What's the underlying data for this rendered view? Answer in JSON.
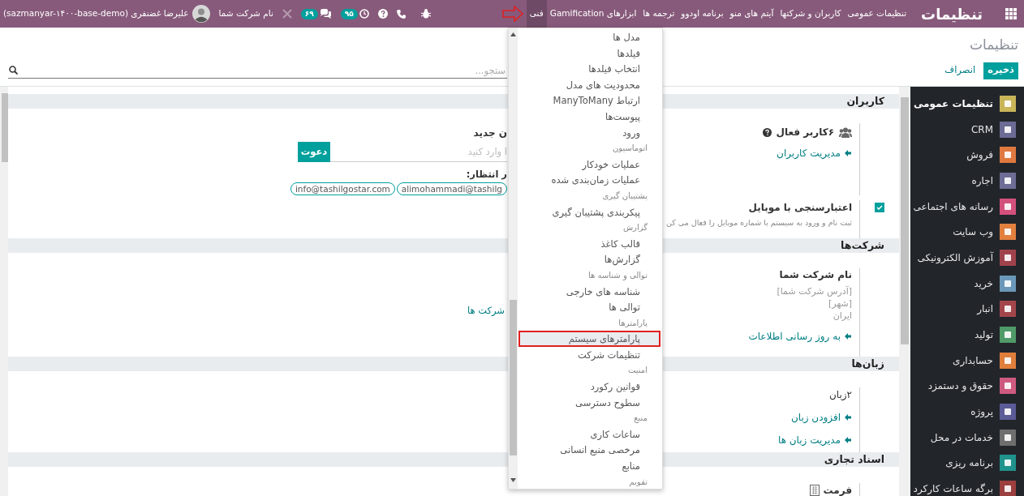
{
  "navbar": {
    "brand": "تنظیمات",
    "menu": [
      {
        "label": "تنظیمات عمومی",
        "selected": false
      },
      {
        "label": "کاربران و شرکتها",
        "selected": false
      },
      {
        "label": "آیتم های منو",
        "selected": false
      },
      {
        "label": "برنامه اودوو",
        "selected": false
      },
      {
        "label": "ترجمه ها",
        "selected": false
      },
      {
        "label": "ابزارهای Gamification",
        "selected": false
      },
      {
        "label": "فنی",
        "selected": true
      }
    ],
    "activity_count": "۹۵",
    "message_count": "۶۹",
    "company": "نام شرکت شما",
    "user": "علیرضا غضنفری (sazmanyar-۱۴۰۰-base-demo)"
  },
  "control_panel": {
    "breadcrumb": "تنظیمات",
    "search": {
      "placeholder": "ستجو..."
    },
    "buttons": [
      {
        "label": "ذخیره",
        "kind": "primary"
      },
      {
        "label": "انصراف",
        "kind": "secondary"
      }
    ]
  },
  "sections": [
    {
      "title": "کاربران",
      "rows": [
        {
          "right": {
            "kind": "users",
            "label": "۶کاربر فعال",
            "link": "مدیریت کاربران"
          },
          "left": {
            "kind": "invite",
            "label": "ن جدید",
            "placeholder": "ا وارد کنید",
            "button": "دعوت",
            "pending_label": "ر انتظار:",
            "pending": [
              "alimohammadi@tashilg",
              "info@tashilgostar.com"
            ]
          }
        },
        {
          "right": {
            "kind": "checkbox",
            "checked": true,
            "label": "اعتبارسنجی با موبایل",
            "description": "ثبت نام و ورود به سیستم با شماره موبایل را فعال می کن"
          }
        }
      ]
    },
    {
      "title": "شرکت‌ها",
      "rows": [
        {
          "right": {
            "kind": "company",
            "name": "نام شرکت شما",
            "lines": [
              "[آدرس شرکت شما]",
              "[شهر]",
              "ایران"
            ],
            "link": "به روز رسانی اطلاعات"
          },
          "left": {
            "kind": "link",
            "label": "شرکت ها"
          }
        }
      ]
    },
    {
      "title": "زبان‌ها",
      "rows": [
        {
          "right": {
            "kind": "info_links",
            "label": "۲زبان",
            "links": [
              "افزودن زبان",
              "مدیریت زبان ها"
            ]
          }
        }
      ]
    },
    {
      "title": "اسناد تجاری",
      "rows": [
        {
          "right": {
            "kind": "format",
            "label": "فرمت"
          }
        }
      ]
    }
  ],
  "technical_menu": {
    "items": [
      {
        "label": "مدل ها",
        "kind": "item",
        "selected": false
      },
      {
        "label": "فیلدها",
        "kind": "item",
        "selected": false
      },
      {
        "label": "انتخاب فیلدها",
        "kind": "item",
        "selected": false
      },
      {
        "label": "محدودیت های مدل",
        "kind": "item",
        "selected": false
      },
      {
        "label": "ارتباط ManyToMany",
        "kind": "item",
        "selected": false
      },
      {
        "label": "پیوست‌ها",
        "kind": "item",
        "selected": false
      },
      {
        "label": "ورود",
        "kind": "item",
        "selected": false
      },
      {
        "label": "اتوماسیون",
        "kind": "header"
      },
      {
        "label": "عملیات خودکار",
        "kind": "item",
        "selected": false
      },
      {
        "label": "عملیات زمان‌بندی شده",
        "kind": "item",
        "selected": false
      },
      {
        "label": "پشتیبان گیری",
        "kind": "header"
      },
      {
        "label": "پیکربندی پشتیبان گیری",
        "kind": "item",
        "selected": false
      },
      {
        "label": "گزارش",
        "kind": "header"
      },
      {
        "label": "قالب کاغذ",
        "kind": "item",
        "selected": false
      },
      {
        "label": "گزارش‌ها",
        "kind": "item",
        "selected": false
      },
      {
        "label": "توالی و شناسه ها",
        "kind": "header"
      },
      {
        "label": "شناسه های خارجی",
        "kind": "item",
        "selected": false
      },
      {
        "label": "توالی ها",
        "kind": "item",
        "selected": false
      },
      {
        "label": "پارامترها",
        "kind": "header"
      },
      {
        "label": "پارامترهای سیستم",
        "kind": "item",
        "selected": true
      },
      {
        "label": "تنظیمات شرکت",
        "kind": "item",
        "selected": false
      },
      {
        "label": "امنیت",
        "kind": "header"
      },
      {
        "label": "قوانین رکورد",
        "kind": "item",
        "selected": false
      },
      {
        "label": "سطوح دسترسی",
        "kind": "item",
        "selected": false
      },
      {
        "label": "منبع",
        "kind": "header"
      },
      {
        "label": "ساعات کاری",
        "kind": "item",
        "selected": false
      },
      {
        "label": "مرخصی منبع انسانی",
        "kind": "item",
        "selected": false
      },
      {
        "label": "منابع",
        "kind": "item",
        "selected": false
      },
      {
        "label": "تقویم",
        "kind": "header"
      }
    ]
  },
  "apps_sidebar": {
    "items": [
      {
        "label": "تنظیمات عمومی",
        "color": "#c9b458",
        "selected": true
      },
      {
        "label": "CRM",
        "color": "#6b6b95",
        "selected": false
      },
      {
        "label": "فروش",
        "color": "#e0793f",
        "selected": false
      },
      {
        "label": "اجاره",
        "color": "#6d6d96",
        "selected": false
      },
      {
        "label": "رسانه های اجتماعی",
        "color": "#d4507c",
        "selected": false
      },
      {
        "label": "وب سایت",
        "color": "#e2803e",
        "selected": false
      },
      {
        "label": "آموزش الکترونیکی",
        "color": "#a0424c",
        "selected": false
      },
      {
        "label": "خرید",
        "color": "#6b98b8",
        "selected": false
      },
      {
        "label": "انبار",
        "color": "#a3464c",
        "selected": false
      },
      {
        "label": "تولید",
        "color": "#4f9a68",
        "selected": false
      },
      {
        "label": "حسابداری",
        "color": "#e07e3c",
        "selected": false
      },
      {
        "label": "حقوق و دستمزد",
        "color": "#cf5a80",
        "selected": false
      },
      {
        "label": "پروژه",
        "color": "#5b5b98",
        "selected": false
      },
      {
        "label": "خدمات در محل",
        "color": "#6e6e6e",
        "selected": false
      },
      {
        "label": "برنامه ریزی",
        "color": "#1f938c",
        "selected": false
      },
      {
        "label": "برگه ساعات کارکرد",
        "color": "#9b3f3f",
        "selected": false
      }
    ]
  }
}
